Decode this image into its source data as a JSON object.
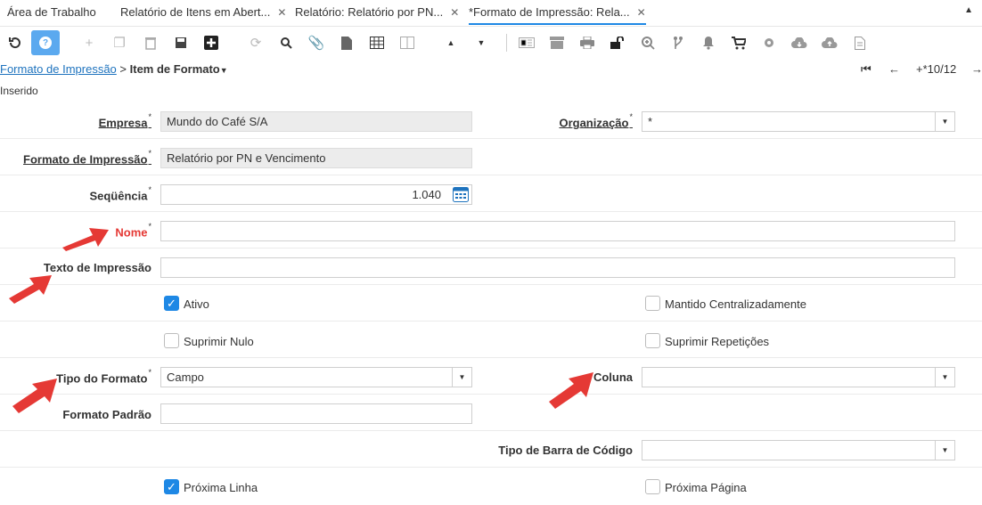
{
  "tabs": [
    {
      "label": "Área de Trabalho",
      "closable": false
    },
    {
      "label": "Relatório de Itens em Abert...",
      "closable": true
    },
    {
      "label": "Relatório: Relatório por PN...",
      "closable": true
    },
    {
      "label": "*Formato de Impressão: Rela...",
      "closable": true
    }
  ],
  "tab_close_glyph": "✕",
  "breadcrumb": {
    "parent": "Formato de Impressão",
    "separator": ">",
    "current": "Item de Formato"
  },
  "record_nav": {
    "counter": "+*10/12"
  },
  "status_text": "Inserido",
  "form": {
    "empresa": {
      "label": "Empresa",
      "value": "Mundo do Café S/A"
    },
    "organizacao": {
      "label": "Organização",
      "value": "*"
    },
    "formato_impressao": {
      "label": "Formato de Impressão",
      "value": "Relatório por PN e Vencimento"
    },
    "sequencia": {
      "label": "Seqüência",
      "value": "1.040"
    },
    "nome": {
      "label": "Nome",
      "value": ""
    },
    "texto_impressao": {
      "label": "Texto de Impressão",
      "value": ""
    },
    "ativo": {
      "label": "Ativo",
      "checked": true
    },
    "mantido_centralizadamente": {
      "label": "Mantido Centralizadamente",
      "checked": false
    },
    "suprimir_nulo": {
      "label": "Suprimir Nulo",
      "checked": false
    },
    "suprimir_repeticoes": {
      "label": "Suprimir Repetições",
      "checked": false
    },
    "tipo_formato": {
      "label": "Tipo do Formato",
      "value": "Campo"
    },
    "coluna": {
      "label": "Coluna",
      "value": ""
    },
    "formato_padrao": {
      "label": "Formato Padrão",
      "value": ""
    },
    "tipo_barra_codigo": {
      "label": "Tipo de Barra de Código",
      "value": ""
    },
    "proxima_linha": {
      "label": "Próxima Linha",
      "checked": true
    },
    "proxima_pagina": {
      "label": "Próxima Página",
      "checked": false
    }
  },
  "required_marker": "*",
  "colors": {
    "accent": "#1e88e5",
    "annotation_arrow": "#e53935",
    "required_label": "#e53935"
  }
}
